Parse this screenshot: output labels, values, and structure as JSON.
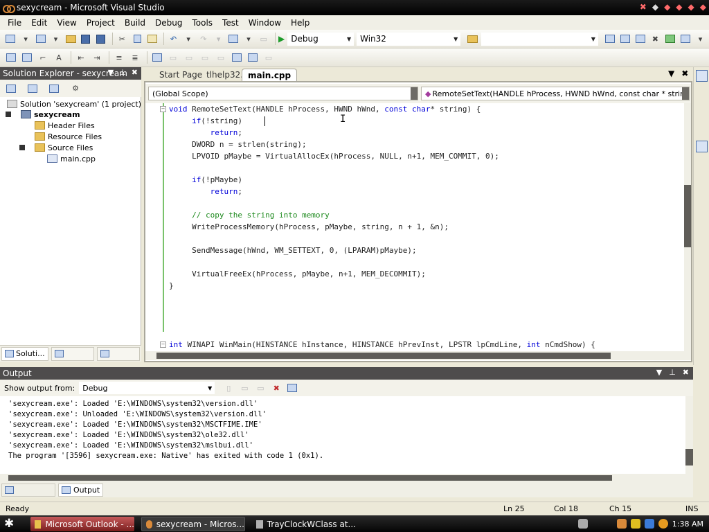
{
  "window": {
    "title": "sexycream - Microsoft Visual Studio"
  },
  "menu": [
    "File",
    "Edit",
    "View",
    "Project",
    "Build",
    "Debug",
    "Tools",
    "Test",
    "Window",
    "Help"
  ],
  "toolbar": {
    "config": "Debug",
    "platform": "Win32"
  },
  "solution_explorer": {
    "title": "Solution Explorer - sexycream",
    "solution": "Solution 'sexycream' (1 project)",
    "project": "sexycream",
    "folders": [
      "Header Files",
      "Resource Files",
      "Source Files"
    ],
    "file": "main.cpp",
    "tabs": [
      "Soluti...",
      "",
      ""
    ]
  },
  "doc_tabs": [
    "Start Page",
    "tlhelp32.h",
    "main.cpp"
  ],
  "editor": {
    "scope_left": "(Global Scope)",
    "scope_right": "RemoteSetText(HANDLE hProcess, HWND hWnd, const char * string)"
  },
  "output": {
    "title": "Output",
    "show_from_label": "Show output from:",
    "show_from_value": "Debug",
    "lines": [
      "'sexycream.exe': Loaded 'E:\\WINDOWS\\system32\\version.dll'",
      "'sexycream.exe': Unloaded 'E:\\WINDOWS\\system32\\version.dll'",
      "'sexycream.exe': Loaded 'E:\\WINDOWS\\system32\\MSCTFIME.IME'",
      "'sexycream.exe': Loaded 'E:\\WINDOWS\\system32\\ole32.dll'",
      "'sexycream.exe': Loaded 'E:\\WINDOWS\\system32\\mslbui.dll'",
      "The program '[3596] sexycream.exe: Native' has exited with code 1 (0x1)."
    ],
    "tabs": [
      "",
      "Output"
    ]
  },
  "status": {
    "ready": "Ready",
    "ln": "Ln 25",
    "col": "Col 18",
    "ch": "Ch 15",
    "mode": "INS"
  },
  "taskbar": {
    "tasks": [
      "Microsoft Outlook - ...",
      "sexycream - Micros...",
      "TrayClockWClass at..."
    ],
    "clock": "1:38 AM"
  }
}
